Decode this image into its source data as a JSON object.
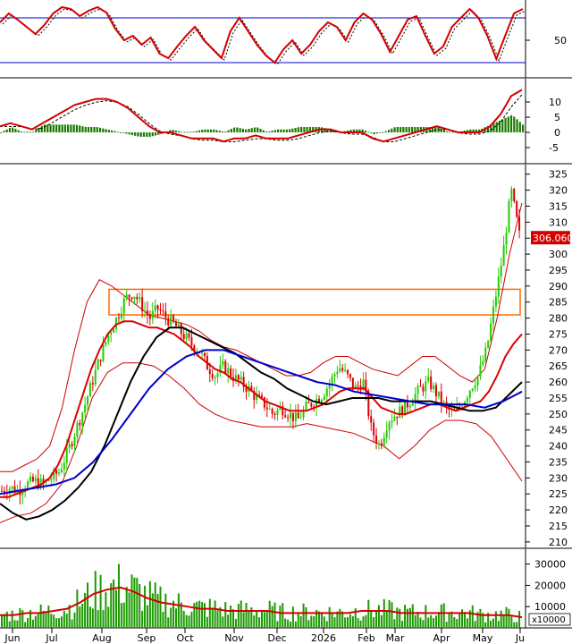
{
  "chart_data": {
    "type": "candlestick",
    "x_axis": {
      "month_labels": [
        "Jun",
        "Jul",
        "Aug",
        "Sep",
        "Oct",
        "Nov",
        "Dec",
        "2026",
        "Feb",
        "Mar",
        "Apr",
        "May",
        "Ju"
      ]
    },
    "price_panel": {
      "ylim": [
        208,
        328
      ],
      "ticks": [
        210,
        215,
        220,
        225,
        230,
        235,
        240,
        245,
        250,
        255,
        260,
        265,
        270,
        275,
        280,
        285,
        290,
        295,
        300,
        305,
        310,
        315,
        320,
        325
      ],
      "last_price_label": "306.060",
      "close_path": [
        226,
        227,
        226,
        228,
        229,
        228,
        230,
        232,
        238,
        245,
        252,
        260,
        268,
        275,
        280,
        286,
        288,
        284,
        280,
        283,
        280,
        278,
        275,
        272,
        270,
        265,
        262,
        265,
        262,
        260,
        258,
        255,
        253,
        250,
        252,
        250,
        248,
        252,
        254,
        256,
        260,
        265,
        262,
        258,
        260,
        245,
        240,
        248,
        250,
        252,
        255,
        258,
        260,
        256,
        252,
        250,
        253,
        258,
        262,
        270,
        285,
        300,
        320,
        306
      ],
      "mid_band_path": [
        224,
        224,
        225,
        226,
        227,
        228,
        230,
        234,
        240,
        248,
        256,
        264,
        270,
        275,
        278,
        279,
        279,
        278,
        277,
        277,
        276,
        275,
        273,
        271,
        268,
        266,
        264,
        263,
        261,
        260,
        258,
        256,
        254,
        253,
        252,
        251,
        251,
        251,
        252,
        253,
        255,
        257,
        258,
        258,
        258,
        255,
        252,
        251,
        250,
        250,
        251,
        252,
        253,
        253,
        252,
        251,
        252,
        253,
        254,
        257,
        262,
        268,
        272,
        275
      ],
      "ma_black_path": [
        222,
        219,
        217,
        218,
        220,
        223,
        227,
        232,
        240,
        250,
        260,
        268,
        274,
        277,
        277,
        275,
        273,
        271,
        269,
        266,
        263,
        261,
        258,
        256,
        254,
        253,
        254,
        255,
        255,
        255,
        254,
        254,
        254,
        254,
        253,
        252,
        251,
        251,
        252,
        256,
        260
      ],
      "ma_blue_path": [
        225,
        226,
        227,
        228,
        230,
        235,
        242,
        250,
        258,
        264,
        268,
        270,
        270,
        268,
        266,
        264,
        262,
        260,
        259,
        257,
        256,
        255,
        254,
        253,
        253,
        253,
        252,
        254,
        257
      ],
      "upper_band_path": [
        232,
        232,
        234,
        236,
        240,
        252,
        270,
        285,
        292,
        290,
        287,
        284,
        281,
        280,
        279,
        278,
        276,
        273,
        271,
        270,
        268,
        266,
        264,
        262,
        262,
        263,
        266,
        268,
        268,
        266,
        264,
        263,
        262,
        265,
        268,
        268,
        265,
        262,
        260,
        264,
        280,
        300,
        316
      ],
      "lower_band_path": [
        216,
        218,
        219,
        222,
        228,
        240,
        255,
        263,
        266,
        266,
        265,
        262,
        258,
        253,
        250,
        248,
        247,
        246,
        246,
        246,
        247,
        246,
        245,
        244,
        242,
        240,
        236,
        240,
        245,
        248,
        248,
        247,
        243,
        236,
        229
      ],
      "resistance_zone": [
        281,
        289
      ]
    },
    "rsi_panel": {
      "ticks": [
        50
      ],
      "levels": [
        70,
        30
      ]
    },
    "macd_panel": {
      "ticks": [
        10,
        5,
        0,
        -5
      ]
    },
    "volume_panel": {
      "ticks": [
        30000,
        20000,
        10000
      ],
      "multiplier_label": "x10000"
    }
  }
}
